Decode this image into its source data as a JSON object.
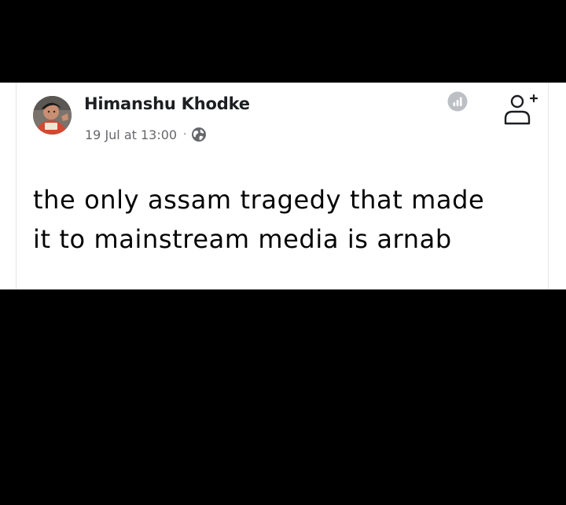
{
  "post": {
    "author": "Himanshu Khodke",
    "timestamp": "19 Jul at 13:00",
    "separator": "·",
    "privacy_icon": "globe-icon",
    "text_lines": [
      "the only assam tragedy that made",
      "it to mainstream media is arnab"
    ]
  },
  "actions": {
    "insights_icon": "insights-icon",
    "add_friend_icon": "add-friend-icon"
  },
  "colors": {
    "background": "#000000",
    "card": "#ffffff",
    "name_text": "#1c1e21",
    "meta_text": "#65676b",
    "post_text": "#050505",
    "icon_gray": "#bcc0c4"
  }
}
